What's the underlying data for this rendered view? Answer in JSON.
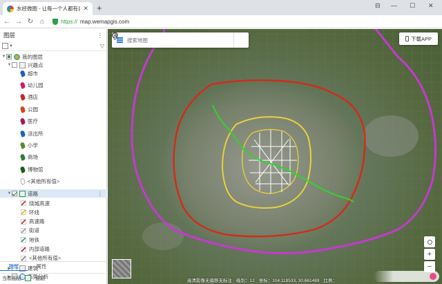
{
  "browser": {
    "tab_title": "水经微图 - 让每一个人都有自",
    "url_scheme": "https://",
    "url_host": "map.wemapgis.com",
    "icons": [
      "back-icon",
      "forward-icon",
      "reload-icon",
      "home-icon",
      "secure-shield-icon",
      "star-icon",
      "grid-icon",
      "scissors-icon",
      "undo-icon",
      "menu-icon"
    ]
  },
  "sidebar": {
    "title": "图层",
    "root": "我的图层",
    "poi_group": "兴趣点",
    "poi_items": [
      "超市",
      "幼儿园",
      "酒店",
      "公园",
      "医疗",
      "派出所",
      "小学",
      "商场",
      "博物馆",
      "<其他所有值>"
    ],
    "poi_colors": [
      "#1f5fbf",
      "#d81b60",
      "#c62828",
      "#d84315",
      "#ad1457",
      "#1565c0",
      "#558b2f",
      "#2e7d32",
      "#1b5e20"
    ],
    "road_group": "道路",
    "road_items": [
      "绕城高速",
      "环线",
      "高速路",
      "街道",
      "地铁",
      "内部道路",
      "<其他所有值>"
    ],
    "road_colors": [
      "#c0392b",
      "#e6b800",
      "#d32f2f",
      "#9e9e9e",
      "#27ae60",
      "#c2185b",
      "#888888"
    ],
    "other_groups": [
      "建筑",
      "态势分析"
    ],
    "tabs": [
      "图层",
      "属性"
    ],
    "status_prefix": "当前图层:",
    "status_layer": "道路"
  },
  "map": {
    "search_placeholder": "搜索地图",
    "app_button": "下载APP",
    "zoom_in": "+",
    "zoom_out": "−",
    "status": {
      "source": "高清影像无偏移无标注",
      "level_label": "级别：",
      "level": "12",
      "coord_label": "坐标：",
      "coord": "104.118533, 30.661489",
      "scale_label": "比例："
    },
    "colors": {
      "outer_ring": "#c43ad0",
      "ring3": "#d42a1a",
      "ring2": "#e8d23a",
      "ring1": "#e8d23a",
      "streets": "#ffffff",
      "metro": "#2fd42f"
    }
  }
}
